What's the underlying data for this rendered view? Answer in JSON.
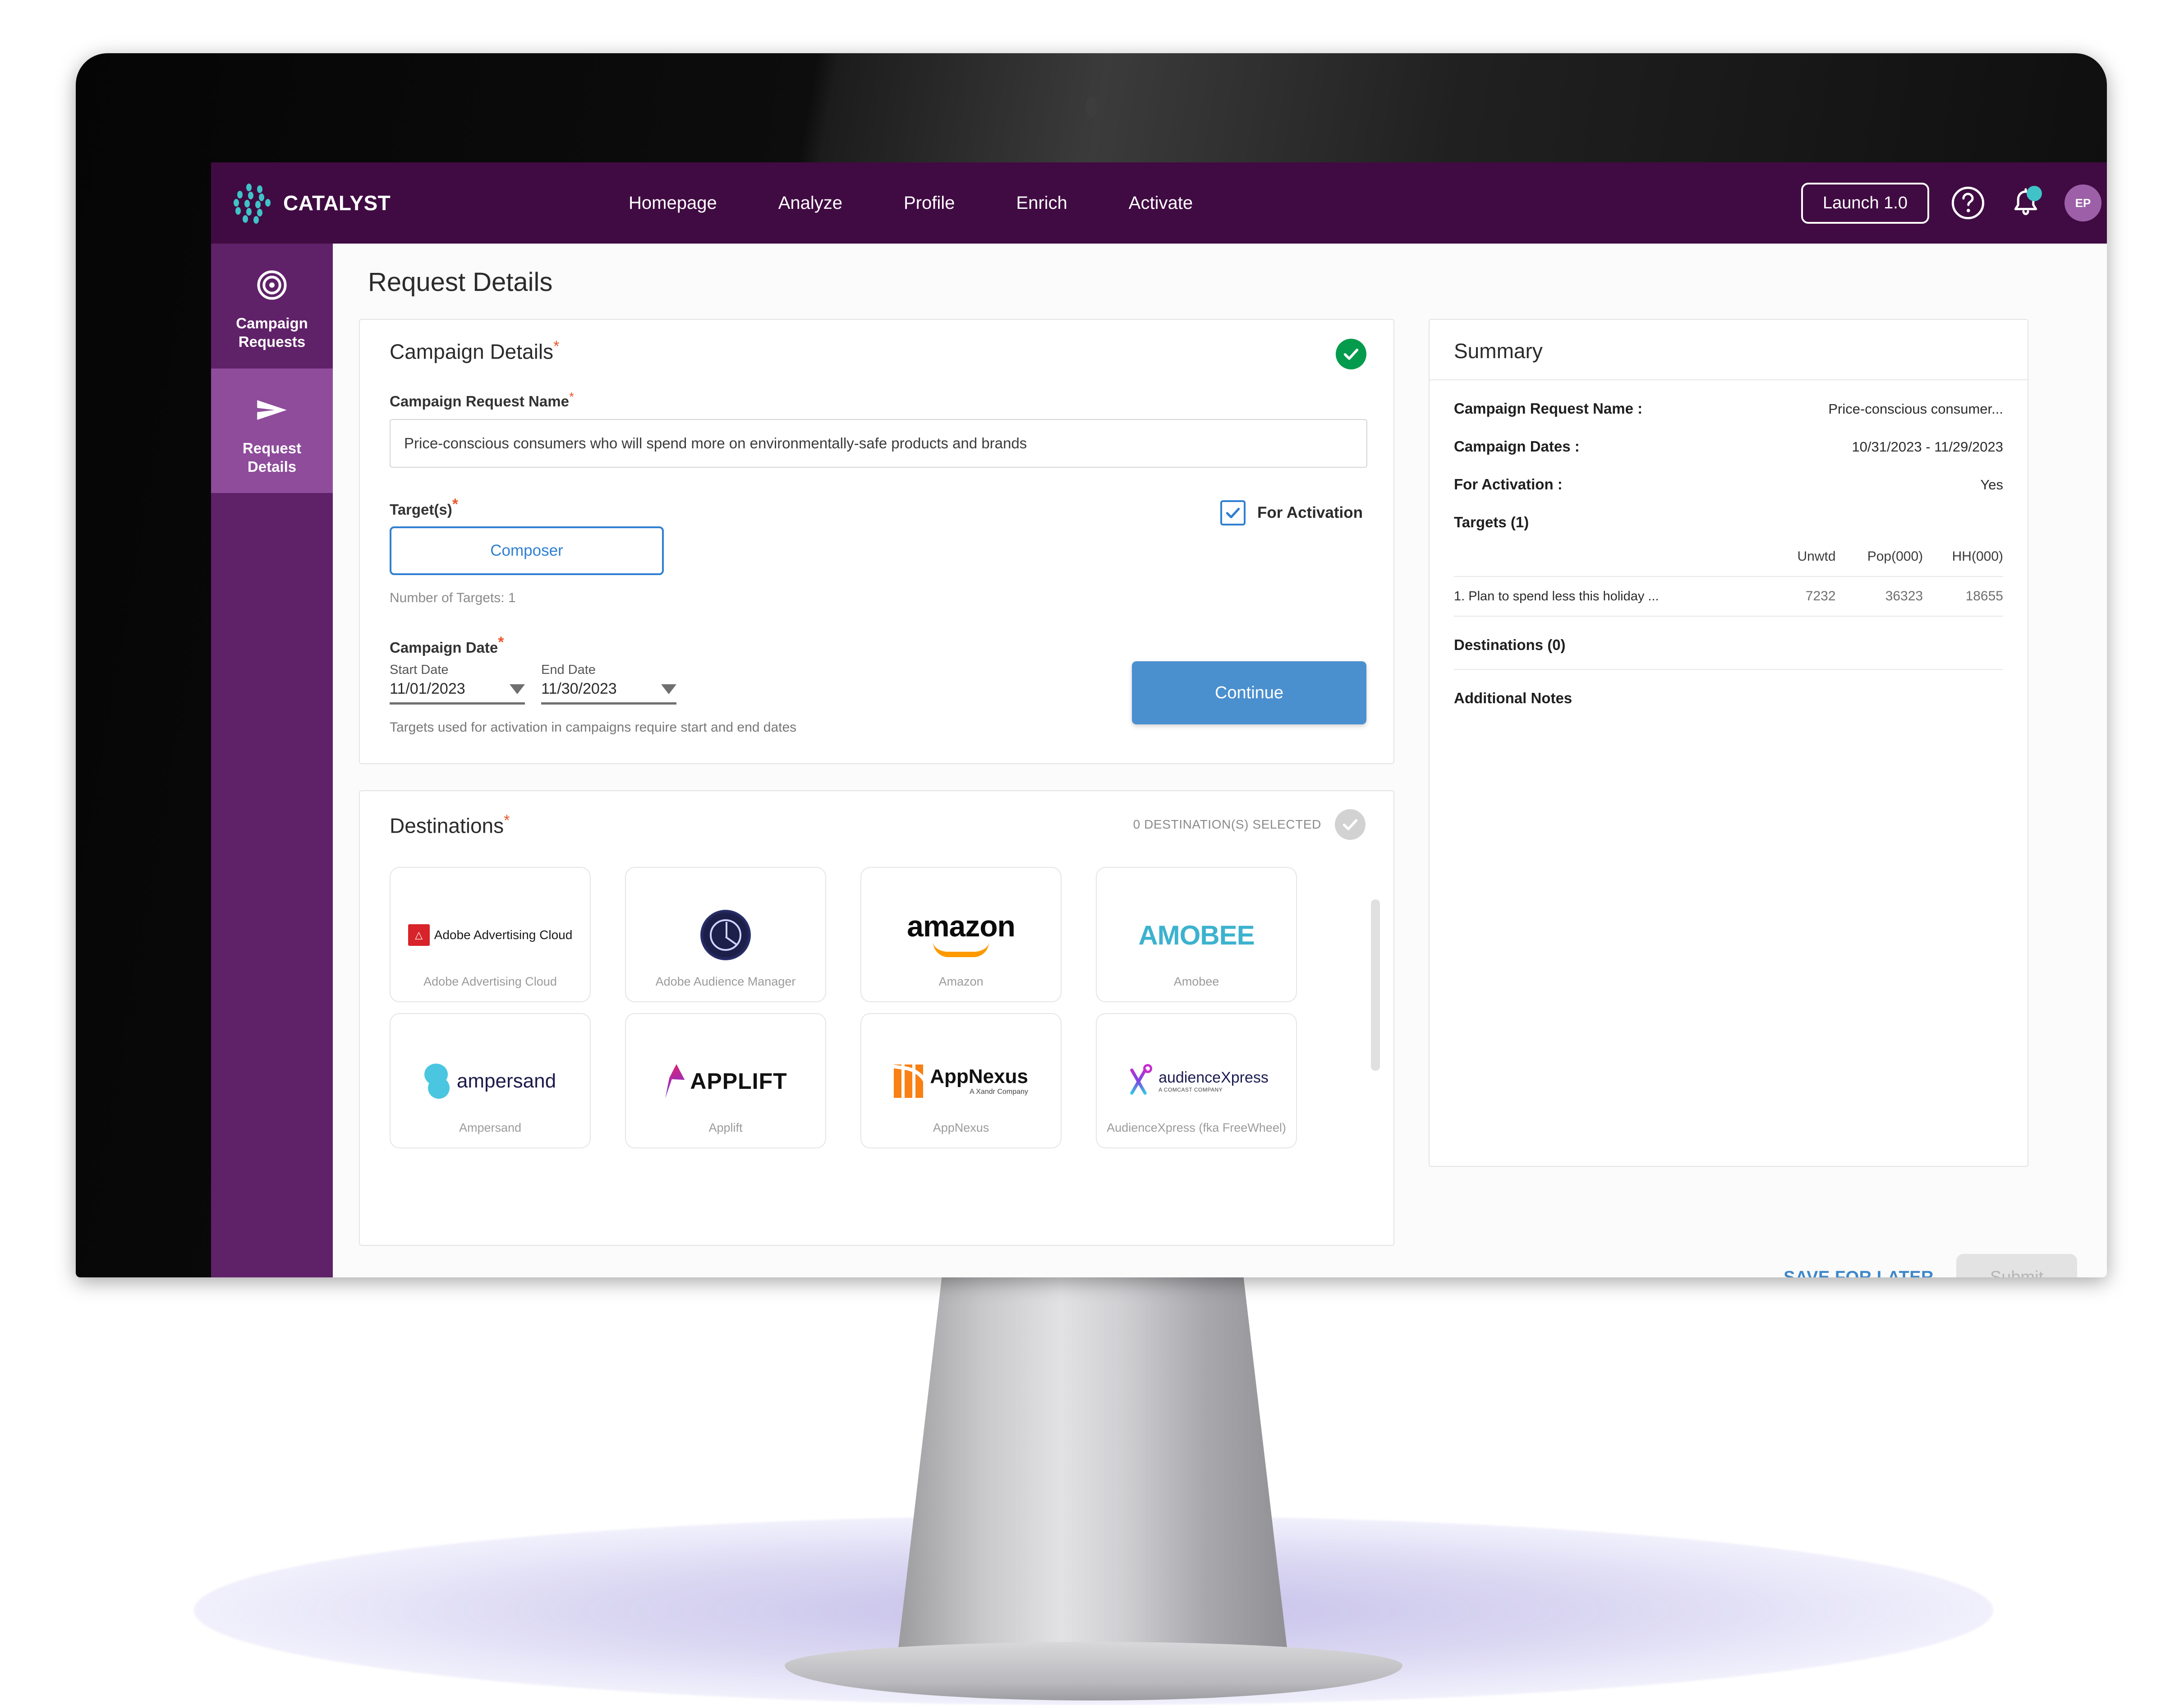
{
  "topnav": {
    "brand": "CATALYST",
    "links": [
      {
        "label": "Homepage"
      },
      {
        "label": "Analyze"
      },
      {
        "label": "Profile"
      },
      {
        "label": "Enrich"
      },
      {
        "label": "Activate"
      }
    ],
    "launch_label": "Launch 1.0",
    "avatar_initials": "EP"
  },
  "sidebar": {
    "items": [
      {
        "label_line1": "Campaign",
        "label_line2": "Requests",
        "icon": "target-icon",
        "active": false
      },
      {
        "label_line1": "Request",
        "label_line2": "Details",
        "icon": "send-icon",
        "active": true
      }
    ]
  },
  "page": {
    "title": "Request Details"
  },
  "campaign_details": {
    "section_title": "Campaign Details",
    "required_marker": "*",
    "name_label": "Campaign Request Name",
    "name_value": "Price-conscious consumers who will spend more on environmentally-safe products and brands",
    "targets_label": "Target(s)",
    "target_chip": "Composer",
    "number_of_targets": "Number of Targets: 1",
    "for_activation_label": "For Activation",
    "for_activation_checked": true,
    "date_label": "Campaign Date",
    "start_date_caption": "Start Date",
    "start_date_value": "11/01/2023",
    "end_date_caption": "End Date",
    "end_date_value": "11/30/2023",
    "date_hint": "Targets used for activation in campaigns require start and end dates",
    "continue_label": "Continue"
  },
  "destinations": {
    "section_title": "Destinations",
    "required_marker": "*",
    "selected_text": "0 DESTINATION(S) SELECTED",
    "cards": [
      {
        "name": "Adobe Advertising Cloud",
        "logo": "adobe-advertising-cloud-logo",
        "logo_text": "Adobe Advertising Cloud"
      },
      {
        "name": "Adobe Audience Manager",
        "logo": "adobe-audience-manager-logo",
        "logo_text": ""
      },
      {
        "name": "Amazon",
        "logo": "amazon-logo",
        "logo_text": "amazon"
      },
      {
        "name": "Amobee",
        "logo": "amobee-logo",
        "logo_text": "AMOBEE"
      },
      {
        "name": "Ampersand",
        "logo": "ampersand-logo",
        "logo_text": "ampersand"
      },
      {
        "name": "Applift",
        "logo": "applift-logo",
        "logo_text": "APPLIFT"
      },
      {
        "name": "AppNexus",
        "logo": "appnexus-logo",
        "logo_text": "AppNexus",
        "logo_subtext": "A Xandr Company"
      },
      {
        "name": "AudienceXpress (fka FreeWheel)",
        "logo": "audiencexpress-logo",
        "logo_text": "audienceXpress",
        "logo_subtext": "A COMCAST COMPANY"
      }
    ]
  },
  "summary": {
    "title": "Summary",
    "rows": [
      {
        "key": "Campaign Request Name :",
        "value": "Price-conscious consumer..."
      },
      {
        "key": "Campaign Dates :",
        "value": "10/31/2023 - 11/29/2023"
      },
      {
        "key": "For Activation :",
        "value": "Yes"
      }
    ],
    "targets_title": "Targets (1)",
    "targets_columns": [
      "",
      "Unwtd",
      "Pop(000)",
      "HH(000)"
    ],
    "targets_rows": [
      {
        "name": "1. Plan to spend less this holiday ...",
        "unwtd": "7232",
        "pop": "36323",
        "hh": "18655"
      }
    ],
    "destinations_title": "Destinations (0)",
    "notes_title": "Additional Notes"
  },
  "actions": {
    "save_label": "SAVE FOR LATER",
    "submit_label": "Submit"
  },
  "colors": {
    "nav_purple": "#400B42",
    "sidebar_purple": "#5F2168",
    "sidebar_active": "#8E4C9B",
    "accent_blue": "#2F7FD1",
    "button_blue": "#4A90CF",
    "success_green": "#049B4C",
    "required_red": "#E8572A",
    "teal": "#3FC3C8"
  }
}
